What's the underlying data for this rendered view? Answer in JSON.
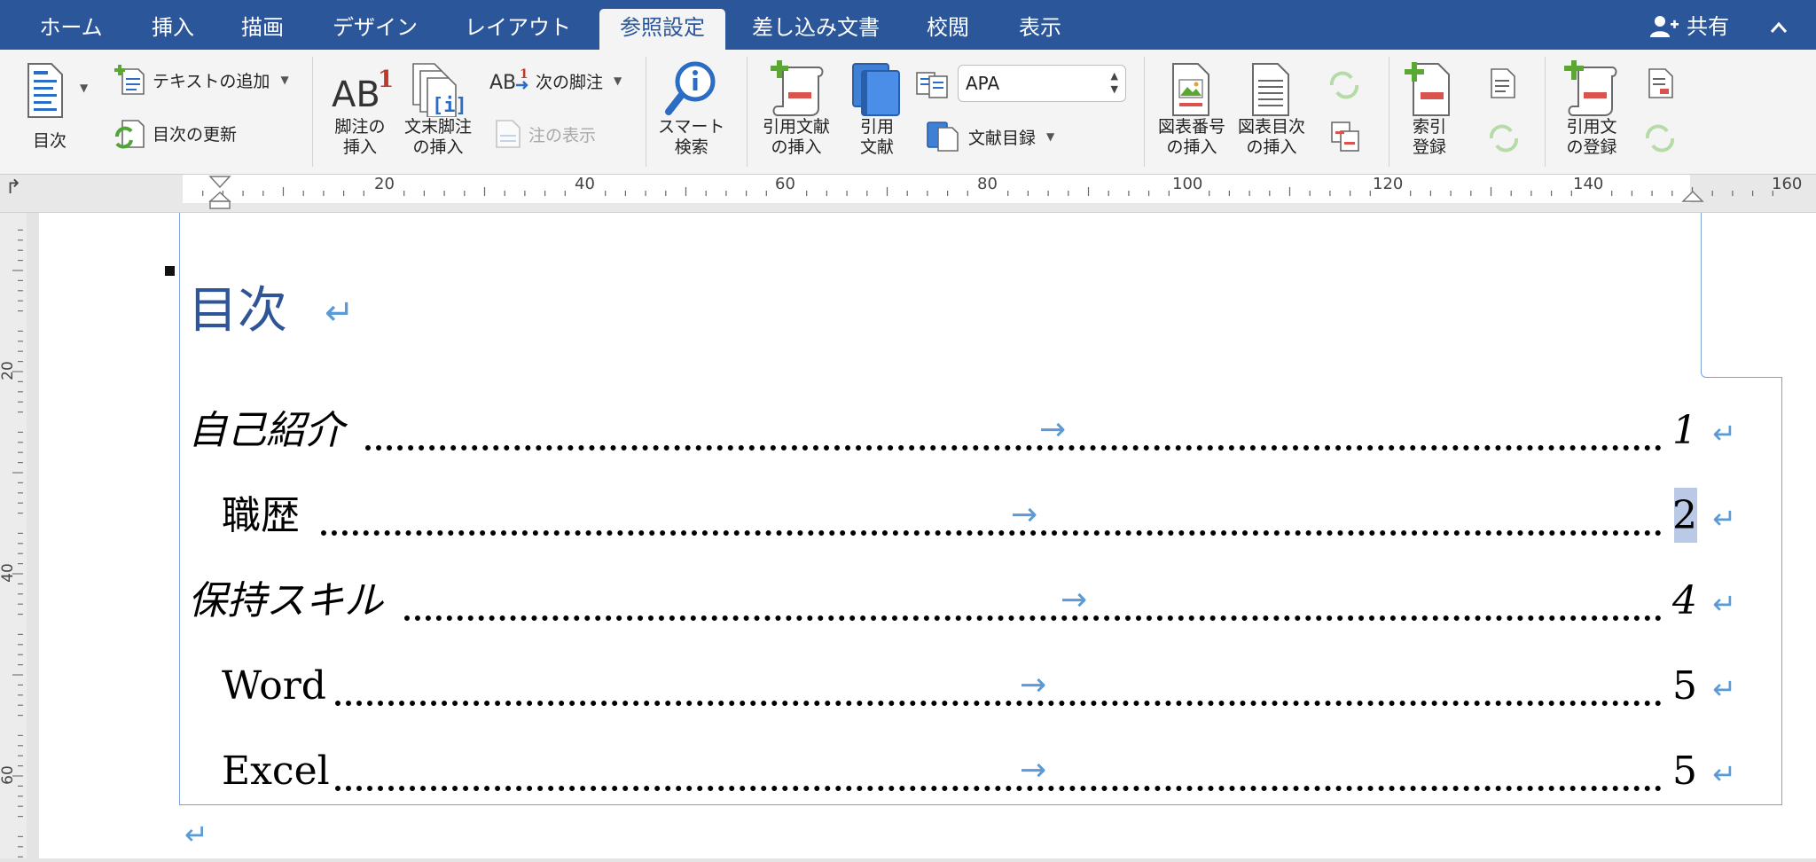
{
  "tabs": [
    {
      "label": "ホーム",
      "active": false
    },
    {
      "label": "挿入",
      "active": false
    },
    {
      "label": "描画",
      "active": false
    },
    {
      "label": "デザイン",
      "active": false
    },
    {
      "label": "レイアウト",
      "active": false
    },
    {
      "label": "参照設定",
      "active": true
    },
    {
      "label": "差し込み文書",
      "active": false
    },
    {
      "label": "校閲",
      "active": false
    },
    {
      "label": "表示",
      "active": false
    }
  ],
  "share_label": "共有",
  "ribbon": {
    "toc": "目次",
    "add_text": "テキストの追加",
    "update_toc": "目次の更新",
    "insert_footnote": [
      "脚注の",
      "挿入"
    ],
    "insert_endnote": [
      "文末脚注",
      "の挿入"
    ],
    "next_footnote": "次の脚注",
    "show_notes": "注の表示",
    "smart_lookup": [
      "スマート",
      "検索"
    ],
    "insert_citation": [
      "引用文献",
      "の挿入"
    ],
    "citations": [
      "引用",
      "文献"
    ],
    "style_value": "APA",
    "bibliography": "文献目録",
    "insert_caption": [
      "図表番号",
      "の挿入"
    ],
    "insert_table_of_figures": [
      "図表目次",
      "の挿入"
    ],
    "mark_entry": [
      "索引",
      "登録"
    ],
    "mark_citation": [
      "引用文",
      "の登録"
    ]
  },
  "ruler": {
    "labels": [
      "20",
      "40",
      "60",
      "80",
      "100",
      "120",
      "140",
      "160"
    ],
    "vertical_labels": [
      "20",
      "40",
      "60"
    ]
  },
  "document": {
    "toc_title": "目次",
    "entries": [
      {
        "text": "自己紹介",
        "page": "1",
        "level": 1
      },
      {
        "text": "職歴",
        "page": "2",
        "level": 2
      },
      {
        "text": "保持スキル",
        "page": "4",
        "level": 1
      },
      {
        "text": "Word",
        "page": "5",
        "level": 2
      },
      {
        "text": "Excel",
        "page": "5",
        "level": 2
      }
    ]
  },
  "colors": {
    "tab_bar": "#2b579a",
    "heading": "#2f5597",
    "formatting_mark": "#5b9bd5",
    "selection": "#b9c9e6"
  },
  "icons": {
    "paragraph_mark": "return-arrow-icon",
    "tab_mark": "right-arrow-icon"
  }
}
